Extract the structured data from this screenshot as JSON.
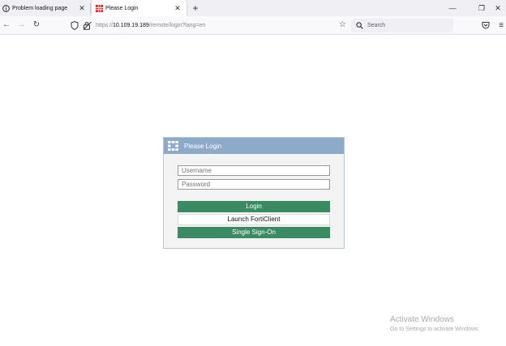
{
  "browser": {
    "tabs": [
      {
        "label": "Problem loading page",
        "icon": "info-icon",
        "active": false
      },
      {
        "label": "Please Login",
        "icon": "fortinet-favicon",
        "active": true
      }
    ],
    "new_tab_label": "+",
    "window_controls": {
      "minimize": "—",
      "restore": "❐",
      "close": "✕"
    },
    "nav": {
      "back": "←",
      "forward": "→",
      "reload": "↻"
    },
    "url": {
      "scheme": "https://",
      "host": "10.109.19.189",
      "path": "/remote/login?lang=en"
    },
    "search_placeholder": "Search",
    "menu_label": "≡"
  },
  "login": {
    "title": "Please Login",
    "username_placeholder": "Username",
    "password_placeholder": "Password",
    "login_button": "Login",
    "forticlient_button": "Launch FortiClient",
    "sso_button": "Single Sign-On",
    "header_color": "#8dabc9",
    "button_color": "#3a8a64"
  },
  "watermark": {
    "line1": "Activate Windows",
    "line2": "Go to Settings to activate Windows."
  }
}
